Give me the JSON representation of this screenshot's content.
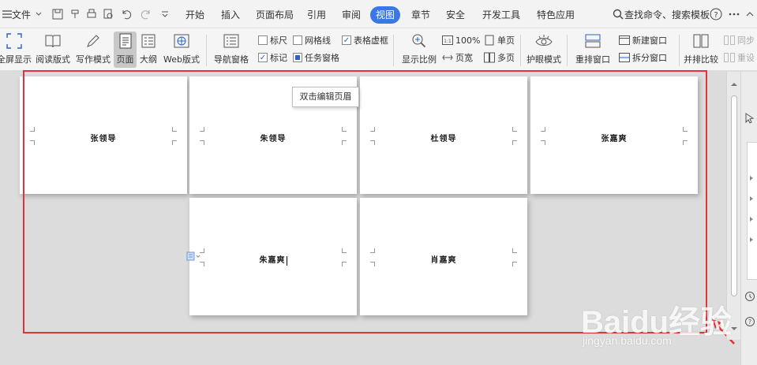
{
  "menubar": {
    "file_label": "文件",
    "tabs": [
      "开始",
      "插入",
      "页面布局",
      "引用",
      "审阅",
      "视图",
      "章节",
      "安全",
      "开发工具",
      "特色应用"
    ],
    "active_tab": "视图",
    "search_label": "查找命令、搜索模板"
  },
  "ribbon": {
    "fullscreen": "全屏显示",
    "read_mode": "阅读版式",
    "write_mode": "写作模式",
    "page_view": "页面",
    "outline": "大纲",
    "web_view": "Web版式",
    "nav_pane": "导航窗格",
    "ruler": "标尺",
    "gridlines": "网格线",
    "table_gridlines": "表格虚框",
    "marks": "标记",
    "task_pane": "任务窗格",
    "zoom": "显示比例",
    "zoom_100": "100%",
    "page_width": "页宽",
    "single_page": "单页",
    "multi_page": "多页",
    "eye_mode": "护眼模式",
    "arrange_windows": "重排窗口",
    "new_window": "新建窗口",
    "split_window": "拆分窗口",
    "side_by_side": "并排比较",
    "sync": "同步",
    "reset": "重设"
  },
  "checks": {
    "ruler": false,
    "gridlines": false,
    "table_gridlines": true,
    "marks": true,
    "task_pane": true
  },
  "pages": [
    {
      "header": "张领导"
    },
    {
      "header": "朱领导"
    },
    {
      "header": "杜领导"
    },
    {
      "header": "张嘉爽"
    },
    {
      "header": "朱嘉爽"
    },
    {
      "header": "肖嘉爽"
    }
  ],
  "tooltip": "双击编辑页眉",
  "watermark": {
    "main": "Baidu经验",
    "sub": "jingyan.baidu.com"
  },
  "colors": {
    "accent": "#3b78e6",
    "highlight_box": "#e0333a"
  }
}
